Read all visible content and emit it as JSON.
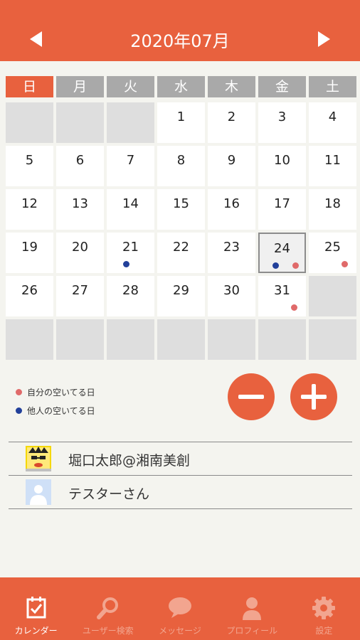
{
  "header": {
    "title": "2020年07月"
  },
  "weekdays": [
    "日",
    "月",
    "火",
    "水",
    "木",
    "金",
    "土"
  ],
  "calendar": {
    "leading_empty": 3,
    "selected_day": 24,
    "days": [
      {
        "d": "1"
      },
      {
        "d": "2"
      },
      {
        "d": "3"
      },
      {
        "d": "4"
      },
      {
        "d": "5"
      },
      {
        "d": "6"
      },
      {
        "d": "7"
      },
      {
        "d": "8"
      },
      {
        "d": "9"
      },
      {
        "d": "10"
      },
      {
        "d": "11"
      },
      {
        "d": "12"
      },
      {
        "d": "13"
      },
      {
        "d": "14"
      },
      {
        "d": "15"
      },
      {
        "d": "16"
      },
      {
        "d": "17"
      },
      {
        "d": "18"
      },
      {
        "d": "19"
      },
      {
        "d": "20"
      },
      {
        "d": "21",
        "other": true
      },
      {
        "d": "22"
      },
      {
        "d": "23"
      },
      {
        "d": "24",
        "self": true,
        "other": true
      },
      {
        "d": "25",
        "self": true
      },
      {
        "d": "26"
      },
      {
        "d": "27"
      },
      {
        "d": "28"
      },
      {
        "d": "29"
      },
      {
        "d": "30"
      },
      {
        "d": "31",
        "self": true
      }
    ],
    "total_cells": 42
  },
  "legend": {
    "self": {
      "label": "自分の空いてる日",
      "color": "#e06a6a"
    },
    "other": {
      "label": "他人の空いてる日",
      "color": "#22409a"
    }
  },
  "buttons": {
    "minus_icon": "minus-icon",
    "plus_icon": "plus-icon"
  },
  "users": [
    {
      "name": "堀口太郎@湘南美創"
    },
    {
      "name": "テスターさん"
    }
  ],
  "tabbar": [
    {
      "label": "カレンダー",
      "icon": "calendar-check-icon",
      "active": true
    },
    {
      "label": "ユーザー検索",
      "icon": "search-icon",
      "active": false
    },
    {
      "label": "メッセージ",
      "icon": "chat-bubble-icon",
      "active": false
    },
    {
      "label": "プロフィール",
      "icon": "person-icon",
      "active": false
    },
    {
      "label": "設定",
      "icon": "gear-icon",
      "active": false
    }
  ],
  "colors": {
    "accent": "#e8613e",
    "weekday_bg": "#a9a9a9",
    "empty_cell": "#dedede"
  }
}
